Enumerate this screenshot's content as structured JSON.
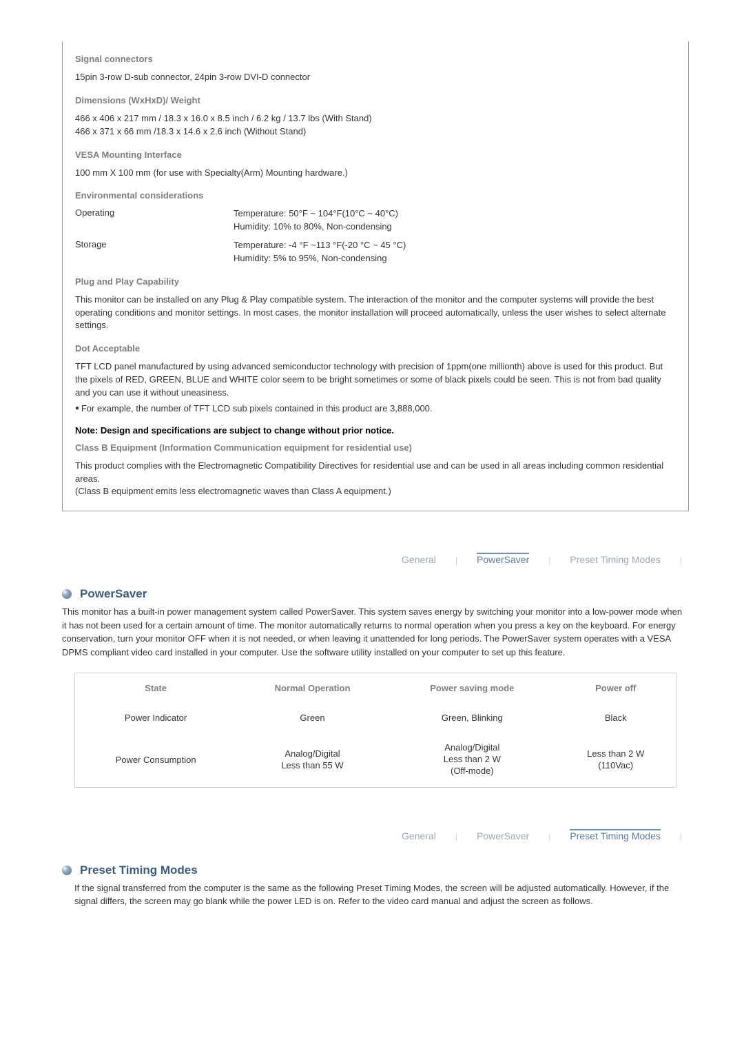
{
  "spec": {
    "signal_connectors": {
      "heading": "Signal connectors",
      "text": "15pin 3-row D-sub connector, 24pin 3-row DVI-D connector"
    },
    "dimensions": {
      "heading": "Dimensions (WxHxD)/ Weight",
      "line1": "466 x 406 x 217 mm / 18.3 x 16.0 x 8.5 inch / 6.2 kg / 13.7 lbs (With Stand)",
      "line2": "466 x 371 x 66 mm /18.3 x 14.6 x 2.6 inch (Without Stand)"
    },
    "vesa": {
      "heading": "VESA Mounting Interface",
      "text": "100 mm X 100 mm (for use with Specialty(Arm) Mounting hardware.)"
    },
    "env": {
      "heading": "Environmental considerations",
      "operating_label": "Operating",
      "operating_temp": "Temperature: 50°F ~ 104°F(10°C ~ 40°C)",
      "operating_hum": "Humidity: 10% to 80%, Non-condensing",
      "storage_label": "Storage",
      "storage_temp": "Temperature: -4 °F ~113 °F(-20 °C ~ 45 °C)",
      "storage_hum": "Humidity: 5% to 95%, Non-condensing"
    },
    "plugplay": {
      "heading": "Plug and Play Capability",
      "text": "This monitor can be installed on any Plug & Play compatible system. The interaction of the monitor and the computer systems will provide the best operating conditions and monitor settings. In most cases, the monitor installation will proceed automatically, unless the user wishes to select alternate settings."
    },
    "dot": {
      "heading": "Dot Acceptable",
      "text": "TFT LCD panel manufactured by using advanced semiconductor technology with precision of 1ppm(one millionth) above is used for this product. But the pixels of RED, GREEN, BLUE and WHITE color seem to be bright sometimes or some of black pixels could be seen. This is not from bad quality and you can use it without uneasiness.",
      "bullet": "For example, the number of TFT LCD sub pixels contained in this product are 3,888,000."
    },
    "note": "Note: Design and specifications are subject to change without prior notice.",
    "classb": {
      "heading": "Class B Equipment (Information Communication equipment for residential use)",
      "text1": "This product complies with the Electromagnetic Compatibility Directives for residential use and can be used in all areas including common residential areas.",
      "text2": "(Class B equipment emits less electromagnetic waves than Class A equipment.)"
    }
  },
  "tabs": {
    "general": "General",
    "powersaver": "PowerSaver",
    "preset": "Preset Timing Modes"
  },
  "powersaver": {
    "title": "PowerSaver",
    "body": "This monitor has a built-in power management system called PowerSaver. This system saves energy by switching your monitor into a low-power mode when it has not been used for a certain amount of time. The monitor automatically returns to normal operation when you press a key on the keyboard. For energy conservation, turn your monitor OFF when it is not needed, or when leaving it unattended for long periods. The PowerSaver system operates with a VESA DPMS compliant video card installed in your computer. Use the software utility installed on your computer to set up this feature.",
    "table": {
      "h_state": "State",
      "h_normal": "Normal Operation",
      "h_saving": "Power saving mode",
      "h_off": "Power off",
      "r1_label": "Power Indicator",
      "r1_normal": "Green",
      "r1_saving": "Green, Blinking",
      "r1_off": "Black",
      "r2_label": "Power Consumption",
      "r2_normal_l1": "Analog/Digital",
      "r2_normal_l2": "Less than 55 W",
      "r2_saving_l1": "Analog/Digital",
      "r2_saving_l2": "Less than 2 W",
      "r2_saving_l3": "(Off-mode)",
      "r2_off_l1": "Less than 2 W",
      "r2_off_l2": "(110Vac)"
    }
  },
  "preset": {
    "title": "Preset Timing Modes",
    "body": "If the signal transferred from the computer is the same as the following Preset Timing Modes, the screen will be adjusted automatically. However, if the signal differs, the screen may go blank while the power LED is on. Refer to the video card manual and adjust the screen as follows."
  }
}
